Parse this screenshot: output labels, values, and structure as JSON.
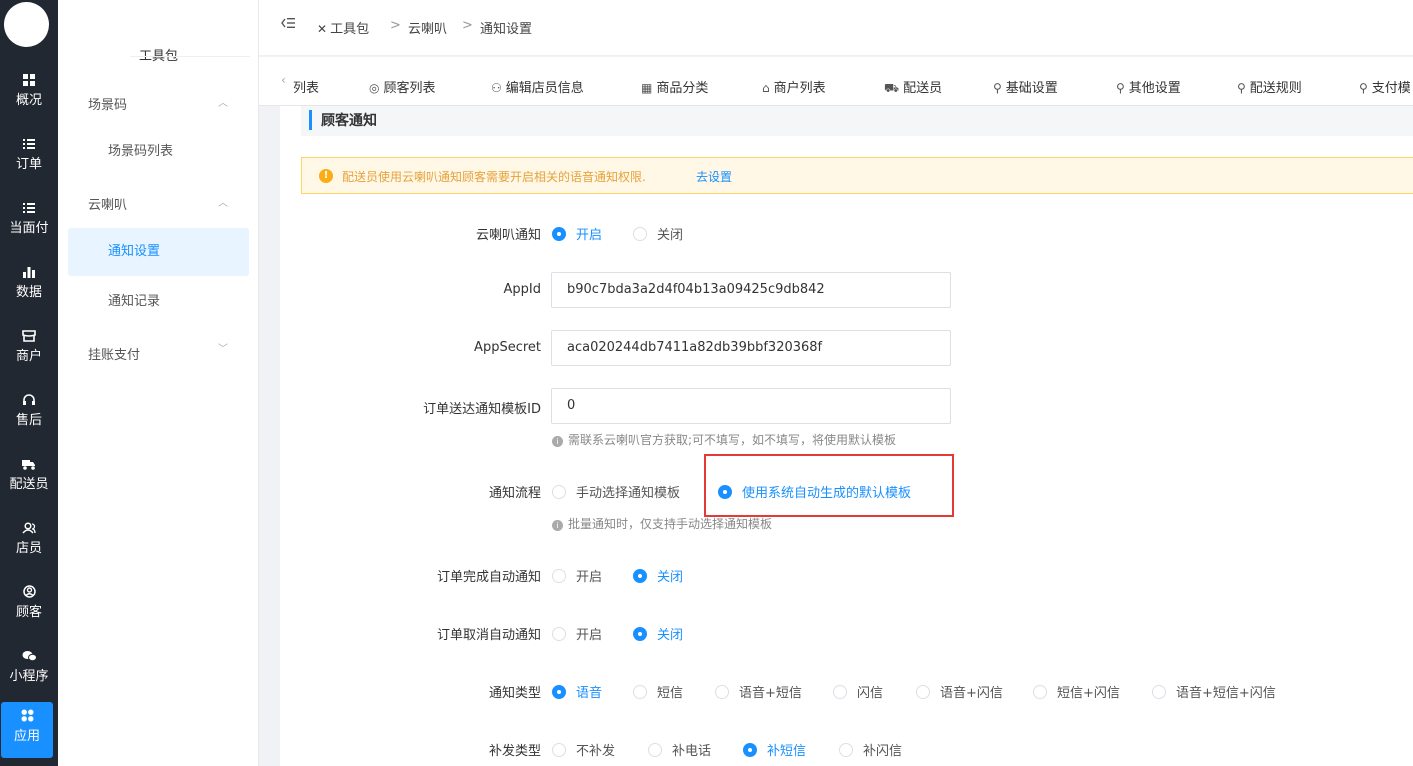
{
  "nav": {
    "items": [
      {
        "label": "概况",
        "icon": "grid-icon"
      },
      {
        "label": "订单",
        "icon": "list-icon"
      },
      {
        "label": "当面付",
        "icon": "list-icon"
      },
      {
        "label": "数据",
        "icon": "bar-chart-icon"
      },
      {
        "label": "商户",
        "icon": "store-icon"
      },
      {
        "label": "售后",
        "icon": "headset-icon"
      },
      {
        "label": "配送员",
        "icon": "delivery-icon"
      },
      {
        "label": "店员",
        "icon": "users-icon"
      },
      {
        "label": "顾客",
        "icon": "user-circle-icon"
      },
      {
        "label": "小程序",
        "icon": "wechat-icon"
      },
      {
        "label": "应用",
        "icon": "apps-icon"
      }
    ],
    "active_color": "#1890ff"
  },
  "submenu": {
    "title": "工具包",
    "groups": [
      {
        "label": "场景码",
        "items": [
          "场景码列表"
        ]
      },
      {
        "label": "云喇叭",
        "items": [
          "通知设置",
          "通知记录"
        ]
      },
      {
        "label": "挂账支付",
        "items": []
      }
    ]
  },
  "header": {
    "breadcrumb": [
      "工具包",
      "云喇叭",
      "通知设置"
    ],
    "separator": ">"
  },
  "tabs": [
    "列表",
    "顾客列表",
    "编辑店员信息",
    "商品分类",
    "商户列表",
    "配送员",
    "基础设置",
    "其他设置",
    "配送规则",
    "支付模"
  ],
  "section": {
    "title": "顾客通知"
  },
  "alert": {
    "text": "配送员使用云喇叭通知顾客需要开启相关的语音通知权限.",
    "link": "去设置"
  },
  "form": {
    "speaker_notify": {
      "label": "云喇叭通知",
      "options": [
        "开启",
        "关闭"
      ],
      "selected": "开启"
    },
    "appid": {
      "label": "AppId",
      "value": "b90c7bda3a2d4f04b13a09425c9db842"
    },
    "appsecret": {
      "label": "AppSecret",
      "value": "aca020244db7411a82db39bbf320368f"
    },
    "template_id": {
      "label": "订单送达通知模板ID",
      "value": "0",
      "hint": "需联系云喇叭官方获取;可不填写，如不填写，将使用默认模板"
    },
    "flow": {
      "label": "通知流程",
      "options": [
        "手动选择通知模板",
        "使用系统自动生成的默认模板"
      ],
      "selected": "使用系统自动生成的默认模板",
      "hint": "批量通知时，仅支持手动选择通知模板"
    },
    "auto_complete": {
      "label": "订单完成自动通知",
      "options": [
        "开启",
        "关闭"
      ],
      "selected": "关闭"
    },
    "auto_cancel": {
      "label": "订单取消自动通知",
      "options": [
        "开启",
        "关闭"
      ],
      "selected": "关闭"
    },
    "notify_type": {
      "label": "通知类型",
      "options": [
        "语音",
        "短信",
        "语音+短信",
        "闪信",
        "语音+闪信",
        "短信+闪信",
        "语音+短信+闪信"
      ],
      "selected": "语音"
    },
    "resend_type": {
      "label": "补发类型",
      "options": [
        "不补发",
        "补电话",
        "补短信",
        "补闪信"
      ],
      "selected": "补短信"
    }
  },
  "colors": {
    "primary": "#1890ff",
    "sidebar": "#222831",
    "warning_bg": "#fff8e6",
    "warning_text": "#e6a23c",
    "highlight": "#e53935"
  }
}
